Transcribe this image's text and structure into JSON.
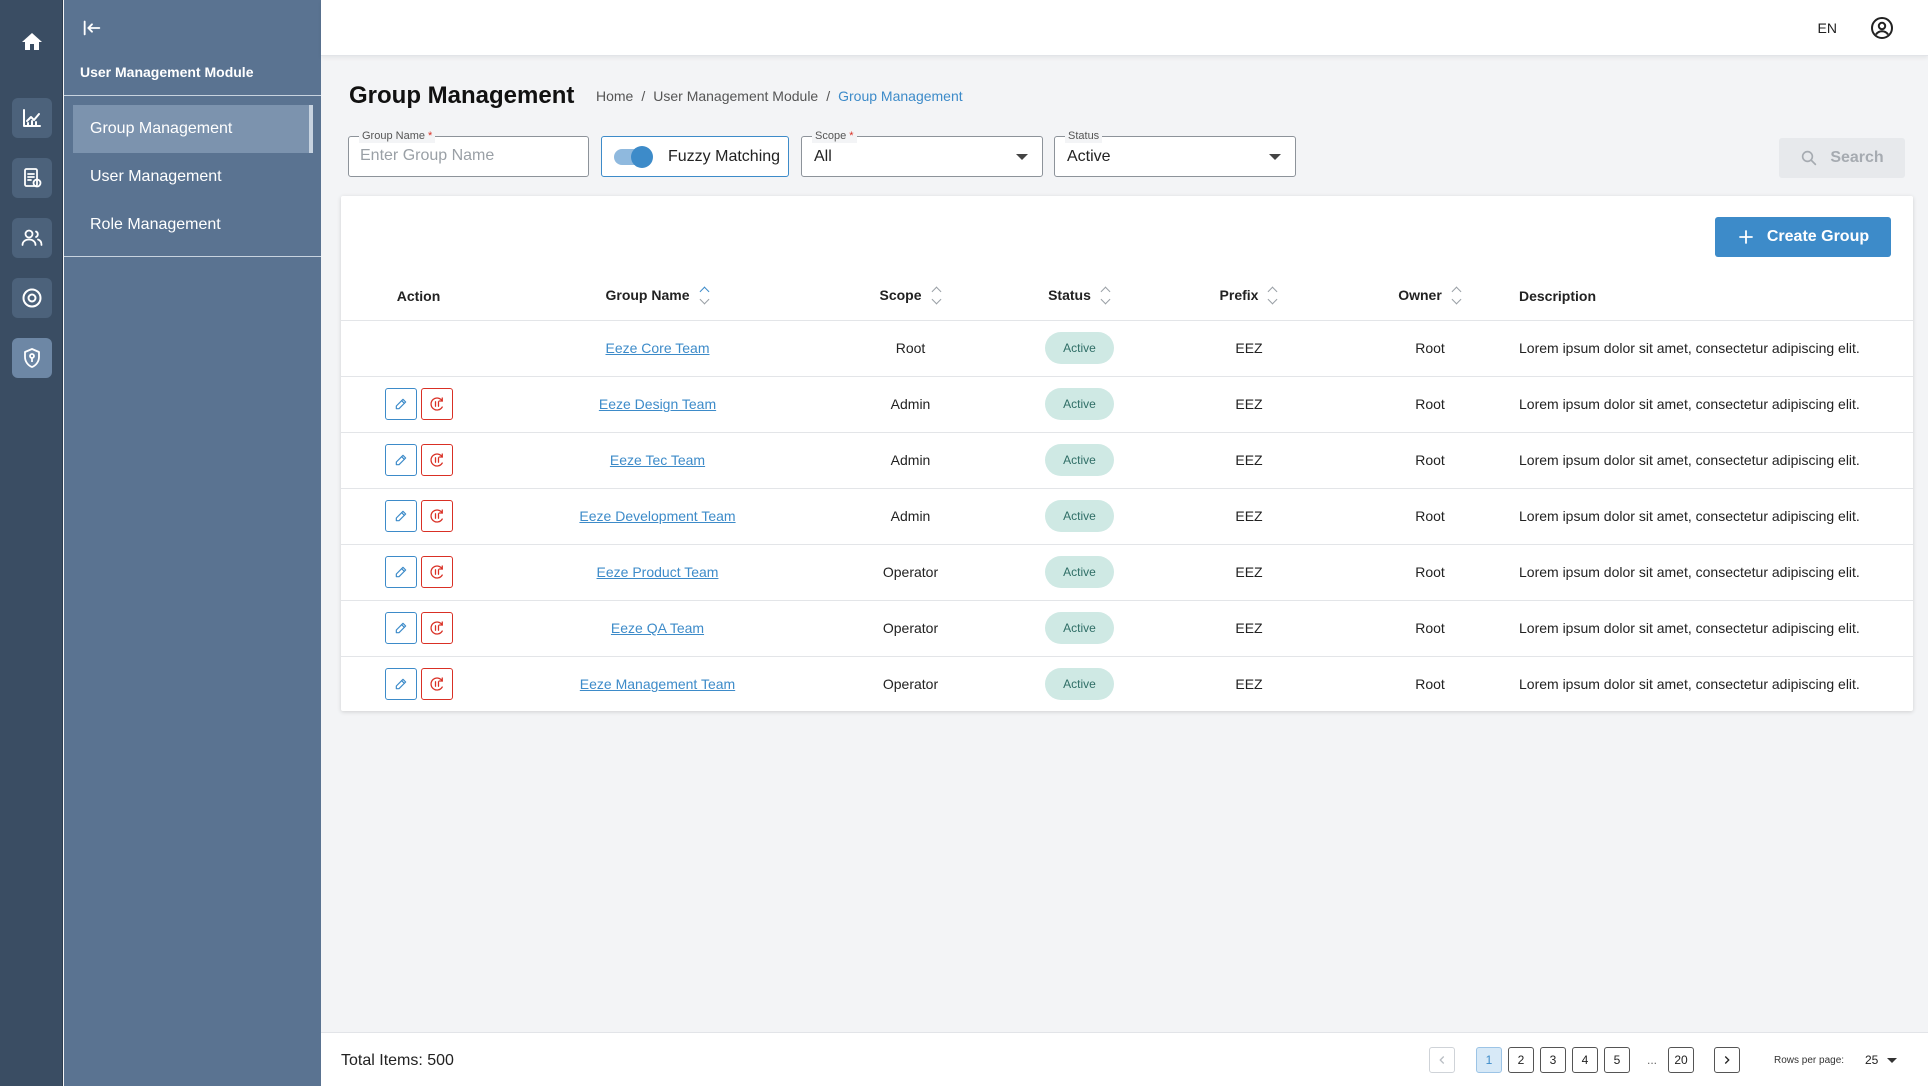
{
  "rail": {
    "items": [
      {
        "icon": "home-icon"
      },
      {
        "icon": "analytics-icon"
      },
      {
        "icon": "report-icon"
      },
      {
        "icon": "users-icon"
      },
      {
        "icon": "settings-icon"
      },
      {
        "icon": "security-shield-icon",
        "active": true
      }
    ]
  },
  "sidebar": {
    "module_title": "User Management Module",
    "items": [
      {
        "label": "Group Management",
        "active": true
      },
      {
        "label": "User Management"
      },
      {
        "label": "Role Management"
      }
    ]
  },
  "header": {
    "language": "EN"
  },
  "page": {
    "title": "Group Management",
    "breadcrumb": [
      "Home",
      "User Management Module",
      "Group Management"
    ]
  },
  "filters": {
    "group_name": {
      "label": "Group Name",
      "required": "*",
      "placeholder": "Enter Group Name",
      "value": ""
    },
    "fuzzy": {
      "label": "Fuzzy Matching",
      "enabled": true
    },
    "scope": {
      "label": "Scope",
      "required": "*",
      "value": "All"
    },
    "status": {
      "label": "Status",
      "value": "Active"
    },
    "search_label": "Search"
  },
  "table": {
    "create_label": "Create Group",
    "columns": [
      "Action",
      "Group Name",
      "Scope",
      "Status",
      "Prefix",
      "Owner",
      "Description"
    ],
    "rows": [
      {
        "group_name": "Eeze Core Team",
        "scope": "Root",
        "status": "Active",
        "prefix": "EEZ",
        "owner": "Root",
        "description": "Lorem ipsum dolor sit amet, consectetur adipiscing elit.",
        "actions": false
      },
      {
        "group_name": "Eeze Design Team",
        "scope": "Admin",
        "status": "Active",
        "prefix": "EEZ",
        "owner": "Root",
        "description": "Lorem ipsum dolor sit amet, consectetur adipiscing elit.",
        "actions": true
      },
      {
        "group_name": "Eeze Tec Team",
        "scope": "Admin",
        "status": "Active",
        "prefix": "EEZ",
        "owner": "Root",
        "description": "Lorem ipsum dolor sit amet, consectetur adipiscing elit.",
        "actions": true
      },
      {
        "group_name": "Eeze Development Team",
        "scope": "Admin",
        "status": "Active",
        "prefix": "EEZ",
        "owner": "Root",
        "description": "Lorem ipsum dolor sit amet, consectetur adipiscing elit.",
        "actions": true
      },
      {
        "group_name": "Eeze Product Team",
        "scope": "Operator",
        "status": "Active",
        "prefix": "EEZ",
        "owner": "Root",
        "description": "Lorem ipsum dolor sit amet, consectetur adipiscing elit.",
        "actions": true
      },
      {
        "group_name": "Eeze QA Team",
        "scope": "Operator",
        "status": "Active",
        "prefix": "EEZ",
        "owner": "Root",
        "description": "Lorem ipsum dolor sit amet, consectetur adipiscing elit.",
        "actions": true
      },
      {
        "group_name": "Eeze Management Team",
        "scope": "Operator",
        "status": "Active",
        "prefix": "EEZ",
        "owner": "Root",
        "description": "Lorem ipsum dolor sit amet, consectetur adipiscing elit.",
        "actions": true
      }
    ]
  },
  "footer": {
    "total_label": "Total Items: 500",
    "pages": [
      "1",
      "2",
      "3",
      "4",
      "5"
    ],
    "ellipsis": "...",
    "last_page": "20",
    "current_page": "1",
    "rows_per_page_label": "Rows per page:",
    "rows_per_page": "25"
  },
  "colors": {
    "accent": "#3d8bc9",
    "rail_bg": "#3a4d63",
    "sidebar_bg": "#5a7391",
    "status_badge_bg": "#cfe9e4",
    "danger": "#d93025"
  }
}
